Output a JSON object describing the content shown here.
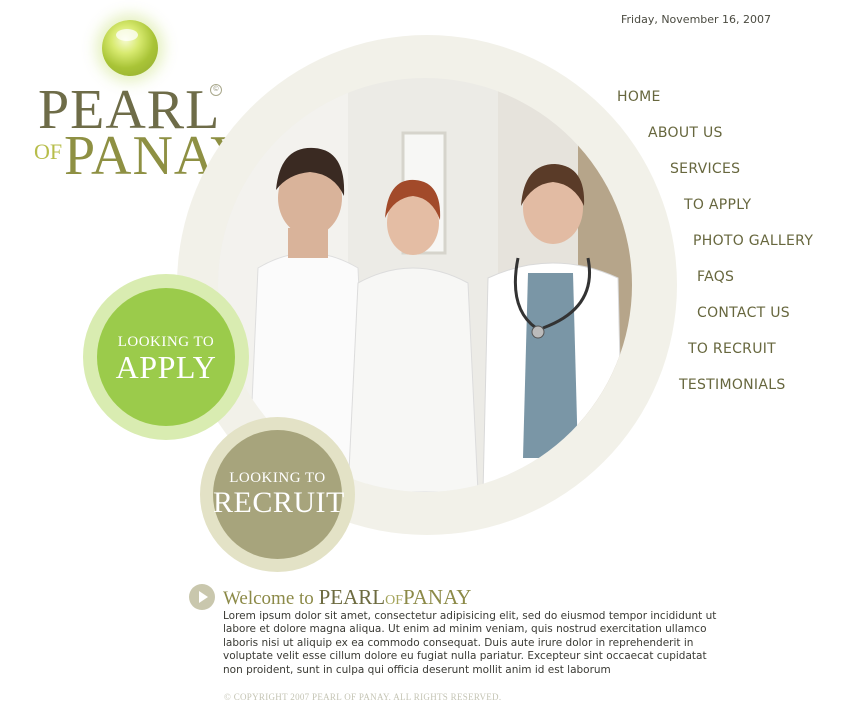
{
  "date": "Friday, November 16, 2007",
  "logo": {
    "line1": "PEARL",
    "of": "OF",
    "line2": "PANAY",
    "copyright_mark": "©"
  },
  "nav": [
    {
      "label": "HOME"
    },
    {
      "label": "ABOUT US"
    },
    {
      "label": "SERVICES"
    },
    {
      "label": "TO APPLY"
    },
    {
      "label": "PHOTO GALLERY"
    },
    {
      "label": "FAQS"
    },
    {
      "label": "CONTACT US"
    },
    {
      "label": "TO RECRUIT"
    },
    {
      "label": "TESTIMONIALS"
    }
  ],
  "apply_badge": {
    "small": "LOOKING TO",
    "big": "APPLY"
  },
  "recruit_badge": {
    "small": "LOOKING TO",
    "big": "RECRUIT"
  },
  "welcome": {
    "prefix": "Welcome to ",
    "brand1": "PEARL",
    "brand_of": "OF",
    "brand2": "PANAY",
    "body": "Lorem ipsum dolor sit amet, consectetur adipisicing elit, sed do eiusmod tempor incididunt ut labore et dolore magna aliqua. Ut enim ad minim veniam, quis nostrud exercitation ullamco laboris nisi ut aliquip ex ea commodo consequat. Duis aute irure dolor in reprehenderit in voluptate velit esse cillum dolore eu fugiat nulla pariatur. Excepteur sint occaecat cupidatat non proident, sunt in culpa qui officia deserunt mollit anim id est laborum"
  },
  "footer": {
    "copyright": "© COPYRIGHT 2007 PEARL OF PANAY. ALL RIGHTS RESERVED."
  },
  "colors": {
    "olive": "#6e6c48",
    "green": "#9bcb4b",
    "khaki": "#a7a47c",
    "ring": "#f2f1e9"
  }
}
